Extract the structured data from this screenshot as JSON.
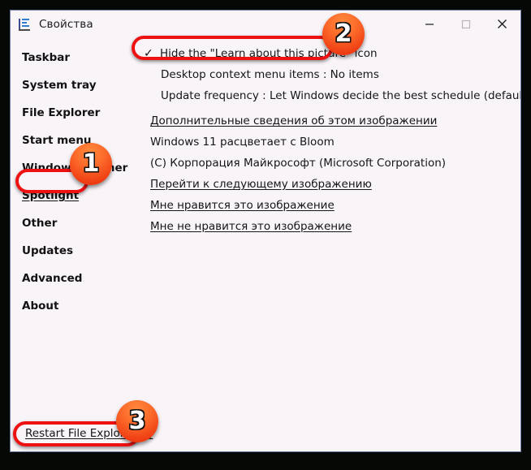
{
  "window": {
    "title": "Свойства",
    "icon": "properties-list-icon",
    "controls": {
      "minimize": "minimize-icon",
      "maximize": "maximize-icon",
      "close": "close-icon"
    }
  },
  "sidebar": {
    "items": [
      {
        "label": "Taskbar",
        "selected": false
      },
      {
        "label": "System tray",
        "selected": false
      },
      {
        "label": "File Explorer",
        "selected": false
      },
      {
        "label": "Start menu",
        "selected": false
      },
      {
        "label": "Window switcher",
        "selected": false
      },
      {
        "label": "Spotlight",
        "selected": true
      },
      {
        "label": "Other",
        "selected": false
      },
      {
        "label": "Updates",
        "selected": false
      },
      {
        "label": "Advanced",
        "selected": false
      },
      {
        "label": "About",
        "selected": false
      }
    ]
  },
  "content": {
    "rows": [
      {
        "kind": "checked",
        "check": "✓",
        "text": "Hide the \"Learn about this picture\" icon"
      },
      {
        "kind": "indent",
        "text": "Desktop context menu items : No items"
      },
      {
        "kind": "indent",
        "text": "Update frequency : Let Windows decide the best schedule (default)"
      },
      {
        "kind": "link",
        "text": "Дополнительные сведения об этом изображении"
      },
      {
        "kind": "plain",
        "text": "Windows 11 расцветает с Bloom"
      },
      {
        "kind": "plain",
        "text": "(C) Корпорация Майкрософт (Microsoft Corporation)"
      },
      {
        "kind": "link",
        "text": "Перейти к следующему изображению"
      },
      {
        "kind": "link",
        "text": "Мне нравится это изображение"
      },
      {
        "kind": "link",
        "text": "Мне не нравится это изображение"
      }
    ]
  },
  "footer": {
    "restart_label": "Restart File Explorer (*)"
  },
  "annotations": {
    "badges": [
      {
        "number": "1",
        "target": "Spotlight sidebar item"
      },
      {
        "number": "2",
        "target": "Hide the Learn about this picture icon option"
      },
      {
        "number": "3",
        "target": "Restart File Explorer link"
      }
    ],
    "highlight_color": "#ee1111",
    "badge_color": "#f4521a"
  }
}
